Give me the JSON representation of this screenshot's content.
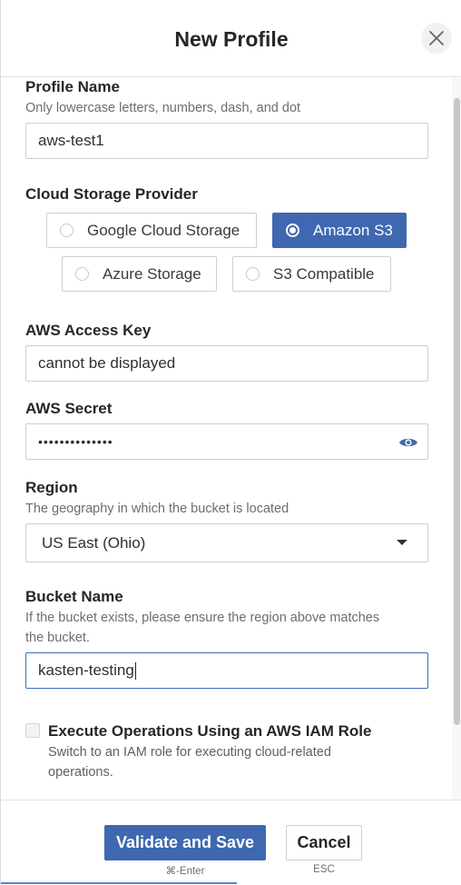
{
  "header": {
    "title": "New Profile",
    "close_icon": "close-icon"
  },
  "profile_name": {
    "label": "Profile Name",
    "help": "Only lowercase letters, numbers, dash, and dot",
    "value": "aws-test1"
  },
  "provider": {
    "label": "Cloud Storage Provider",
    "options": [
      {
        "label": "Google Cloud Storage",
        "selected": false
      },
      {
        "label": "Amazon S3",
        "selected": true
      },
      {
        "label": "Azure Storage",
        "selected": false
      },
      {
        "label": "S3 Compatible",
        "selected": false
      }
    ]
  },
  "access_key": {
    "label": "AWS Access Key",
    "value": "cannot be displayed"
  },
  "secret": {
    "label": "AWS Secret",
    "value": "••••••••••••••",
    "reveal_icon": "eye-icon"
  },
  "region": {
    "label": "Region",
    "help": "The geography in which the bucket is located",
    "value": "US East (Ohio)",
    "dropdown_icon": "caret-down-icon"
  },
  "bucket": {
    "label": "Bucket Name",
    "help_line1": "If the bucket exists, please ensure the region above matches",
    "help_line2": "the bucket.",
    "value": "kasten-testing"
  },
  "iam_role": {
    "label": "Execute Operations Using an AWS IAM Role",
    "help_line1": "Switch to an IAM role for executing cloud-related",
    "help_line2": "operations.",
    "checked": false
  },
  "footer": {
    "save_label": "Validate and Save",
    "save_shortcut": "⌘-Enter",
    "cancel_label": "Cancel",
    "cancel_shortcut": "ESC"
  },
  "colors": {
    "accent": "#3f68b0",
    "focus": "#3f6fb5",
    "text": "#262626",
    "muted": "#6d6d6d"
  }
}
